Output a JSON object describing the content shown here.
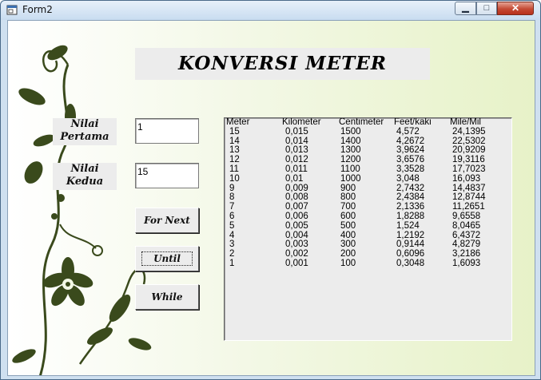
{
  "window": {
    "title": "Form2"
  },
  "header": {
    "title": "KONVERSI METER"
  },
  "inputs": {
    "first_label": "Nilai Pertama",
    "first_value": "1",
    "second_label": "Nilai Kedua",
    "second_value": "15"
  },
  "buttons": {
    "for_next": "For Next",
    "until": "Until",
    "while": "While"
  },
  "table": {
    "headers": [
      "Meter",
      "Kilometer",
      "Centimeter",
      "Feet/kaki",
      "Mile/Mil"
    ],
    "rows": [
      [
        "15",
        "0,015",
        "1500",
        "4,572",
        "24,1395"
      ],
      [
        "14",
        "0,014",
        "1400",
        "4,2672",
        "22,5302"
      ],
      [
        "13",
        "0,013",
        "1300",
        "3,9624",
        "20,9209"
      ],
      [
        "12",
        "0,012",
        "1200",
        "3,6576",
        "19,3116"
      ],
      [
        "11",
        "0,011",
        "1100",
        "3,3528",
        "17,7023"
      ],
      [
        "10",
        "0,01",
        "1000",
        "3,048",
        "16,093"
      ],
      [
        "9",
        "0,009",
        "900",
        "2,7432",
        "14,4837"
      ],
      [
        "8",
        "0,008",
        "800",
        "2,4384",
        "12,8744"
      ],
      [
        "7",
        "0,007",
        "700",
        "2,1336",
        "11,2651"
      ],
      [
        "6",
        "0,006",
        "600",
        "1,8288",
        "9,6558"
      ],
      [
        "5",
        "0,005",
        "500",
        "1,524",
        "8,0465"
      ],
      [
        "4",
        "0,004",
        "400",
        "1,2192",
        "6,4372"
      ],
      [
        "3",
        "0,003",
        "300",
        "0,9144",
        "4,8279"
      ],
      [
        "2",
        "0,002",
        "200",
        "0,6096",
        "3,2186"
      ],
      [
        "1",
        "0,001",
        "100",
        "0,3048",
        "1,6093"
      ]
    ]
  },
  "colors": {
    "vine": "#3a4a1c",
    "form_bg_end": "#e7f2c8",
    "control_gray": "#ececec"
  },
  "icons": [
    "form-app-icon",
    "minimize-icon",
    "maximize-icon",
    "close-icon",
    "floral-vine-decoration"
  ]
}
